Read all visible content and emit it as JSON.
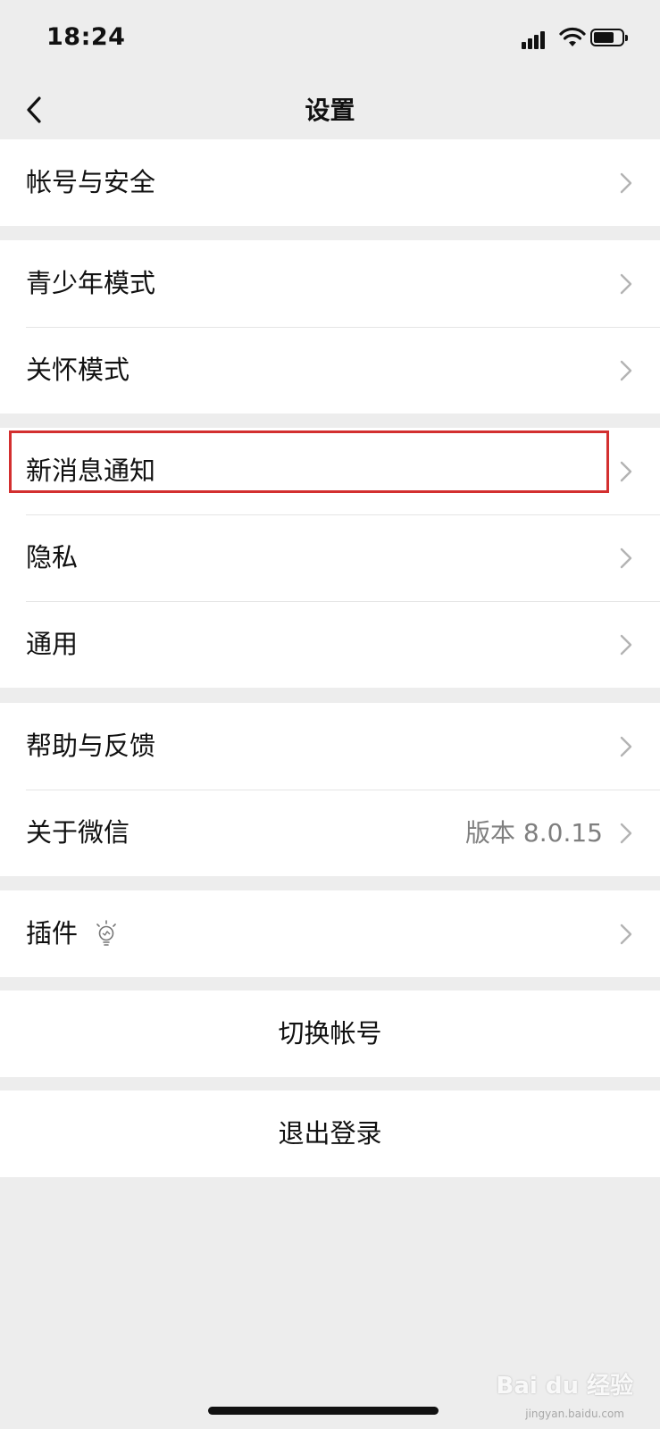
{
  "status_bar": {
    "time": "18:24"
  },
  "header": {
    "title": "设置"
  },
  "groups": [
    {
      "items": [
        {
          "label": "帐号与安全"
        }
      ]
    },
    {
      "items": [
        {
          "label": "青少年模式"
        },
        {
          "label": "关怀模式"
        }
      ]
    },
    {
      "items": [
        {
          "label": "新消息通知"
        },
        {
          "label": "隐私"
        },
        {
          "label": "通用"
        }
      ]
    },
    {
      "items": [
        {
          "label": "帮助与反馈"
        },
        {
          "label": "关于微信",
          "value": "版本 8.0.15"
        }
      ]
    },
    {
      "items": [
        {
          "label": "插件",
          "icon": "lightbulb-icon"
        }
      ]
    }
  ],
  "actions": {
    "switch_account": "切换帐号",
    "logout": "退出登录"
  },
  "annotation": {
    "highlight_color": "#d32f2f"
  },
  "watermark": {
    "text": "Bai du 经验",
    "sub": "jingyan.baidu.com"
  }
}
